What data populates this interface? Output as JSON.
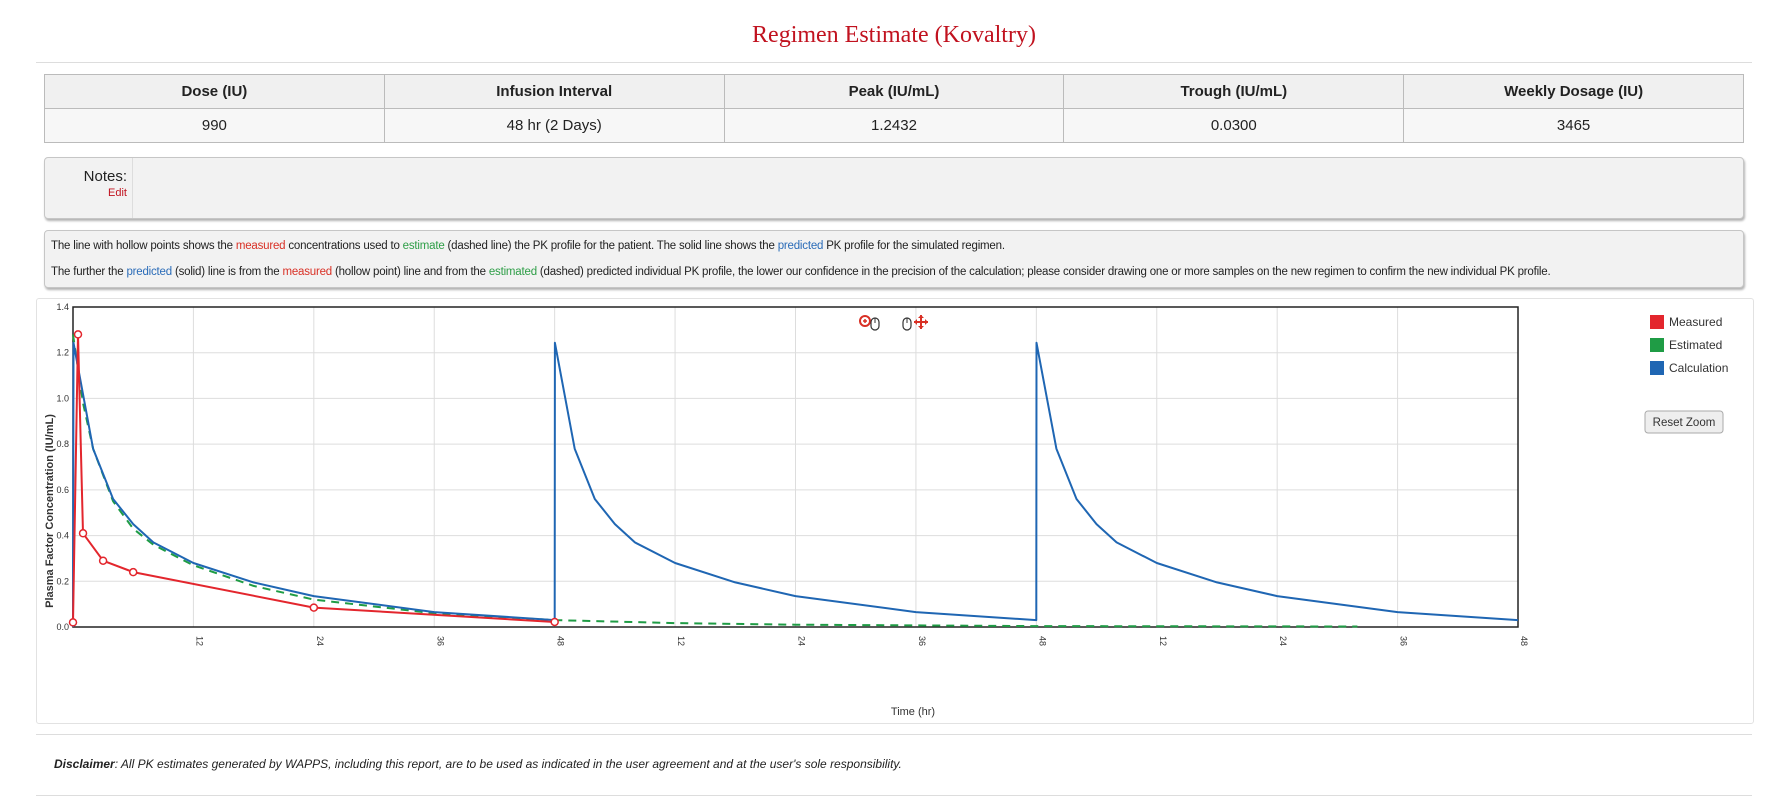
{
  "title": "Regimen Estimate (Kovaltry)",
  "summary": {
    "headers": [
      "Dose (IU)",
      "Infusion Interval",
      "Peak (IU/mL)",
      "Trough (IU/mL)",
      "Weekly Dosage (IU)"
    ],
    "values": [
      "990",
      "48 hr (2 Days)",
      "1.2432",
      "0.0300",
      "3465"
    ]
  },
  "notes": {
    "label": "Notes:",
    "edit": "Edit"
  },
  "info": {
    "line1": [
      "The line with hollow points shows the ",
      "measured",
      " concentrations used to ",
      "estimate",
      " (dashed line) the PK profile for the patient. The solid line shows the ",
      "predicted",
      " PK profile for the simulated regimen."
    ],
    "line2": [
      "The further the ",
      "predicted",
      " (solid) line is from the ",
      "measured",
      " (hollow point) line and from the ",
      "estimated",
      " (dashed) predicted individual PK profile, the lower our confidence in the precision of the calculation; please consider drawing one or more samples on the new regimen to confirm the new individual PK profile."
    ]
  },
  "chart_data": {
    "type": "line",
    "xlabel": "Time (hr)",
    "ylabel": "Plasma Factor Concentration (IU/mL)",
    "xlim": [
      0,
      144
    ],
    "ylim": [
      0,
      1.4
    ],
    "yticks": [
      "0.0",
      "0.2",
      "0.4",
      "0.6",
      "0.8",
      "1.0",
      "1.2",
      "1.4"
    ],
    "xticks": [
      {
        "x": 12,
        "label": "12"
      },
      {
        "x": 24,
        "label": "24"
      },
      {
        "x": 36,
        "label": "36"
      },
      {
        "x": 48,
        "label": "48"
      },
      {
        "x": 60,
        "label": "12"
      },
      {
        "x": 72,
        "label": "24"
      },
      {
        "x": 84,
        "label": "36"
      },
      {
        "x": 96,
        "label": "48"
      },
      {
        "x": 108,
        "label": "12"
      },
      {
        "x": 120,
        "label": "24"
      },
      {
        "x": 132,
        "label": "36"
      },
      {
        "x": 144,
        "label": "48"
      }
    ],
    "grid": true,
    "legend_position": "top-right",
    "series": [
      {
        "name": "Measured",
        "color": "#e3262d",
        "style": "solid-hollow-points",
        "points": [
          [
            0,
            0.02
          ],
          [
            0.5,
            1.28
          ],
          [
            1,
            0.41
          ],
          [
            3,
            0.29
          ],
          [
            6,
            0.24
          ],
          [
            24,
            0.085
          ],
          [
            48,
            0.022
          ]
        ]
      },
      {
        "name": "Estimated",
        "color": "#1f9c45",
        "style": "dashed",
        "points": [
          [
            0,
            1.28
          ],
          [
            1,
            0.98
          ],
          [
            2,
            0.78
          ],
          [
            4,
            0.55
          ],
          [
            6,
            0.43
          ],
          [
            8,
            0.36
          ],
          [
            12,
            0.27
          ],
          [
            18,
            0.18
          ],
          [
            24,
            0.12
          ],
          [
            36,
            0.06
          ],
          [
            48,
            0.03
          ],
          [
            60,
            0.017
          ],
          [
            72,
            0.01
          ],
          [
            96,
            0.004
          ],
          [
            128,
            0.002
          ]
        ]
      },
      {
        "name": "Calculation",
        "color": "#1f66b3",
        "style": "solid",
        "points": [
          [
            0,
            0.0
          ],
          [
            0.05,
            1.2432
          ],
          [
            2,
            0.78
          ],
          [
            4,
            0.56
          ],
          [
            6,
            0.45
          ],
          [
            8,
            0.37
          ],
          [
            12,
            0.28
          ],
          [
            18,
            0.195
          ],
          [
            24,
            0.135
          ],
          [
            36,
            0.065
          ],
          [
            48,
            0.03
          ],
          [
            48.02,
            1.2432
          ],
          [
            50,
            0.78
          ],
          [
            52,
            0.56
          ],
          [
            54,
            0.45
          ],
          [
            56,
            0.37
          ],
          [
            60,
            0.28
          ],
          [
            66,
            0.195
          ],
          [
            72,
            0.135
          ],
          [
            84,
            0.065
          ],
          [
            96,
            0.03
          ],
          [
            96.02,
            1.2432
          ],
          [
            98,
            0.78
          ],
          [
            100,
            0.56
          ],
          [
            102,
            0.45
          ],
          [
            104,
            0.37
          ],
          [
            108,
            0.28
          ],
          [
            114,
            0.195
          ],
          [
            120,
            0.135
          ],
          [
            132,
            0.065
          ],
          [
            144,
            0.03
          ]
        ]
      }
    ]
  },
  "chart_ui": {
    "reset_zoom": "Reset Zoom"
  },
  "disclaimer": {
    "label": "Disclaimer",
    "text": ": All PK estimates generated by WAPPS, including this report, are to be used as indicated in the user agreement and at the user's sole responsibility."
  }
}
